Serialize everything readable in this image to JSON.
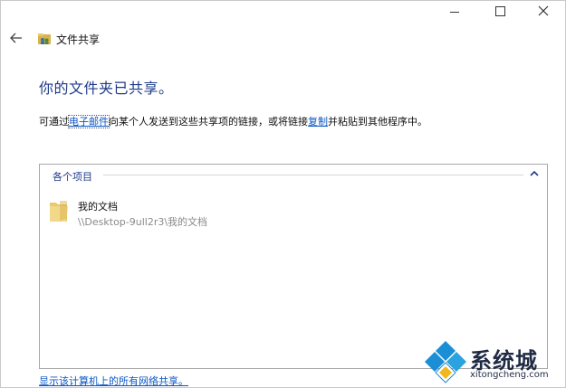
{
  "window": {
    "title": "文件共享",
    "caption": {
      "minimize": "minimize",
      "maximize": "maximize",
      "close": "close"
    }
  },
  "main": {
    "heading": "你的文件夹已共享。",
    "desc_before": "可通过",
    "email_link": "电子邮件",
    "desc_middle": "向某个人发送到这些共享项的链接，或将链接",
    "copy_link": "复制",
    "desc_after": "并粘贴到其他程序中。"
  },
  "panel": {
    "title": "各个项目",
    "items": [
      {
        "name": "我的文档",
        "path": "\\\\Desktop-9ull2r3\\我的文档",
        "icon": "folder-icon"
      }
    ]
  },
  "footer": {
    "link": "显示该计算机上的所有网络共享。"
  },
  "watermark": {
    "brand": "系统城",
    "url": "xitongcheng.com"
  },
  "colors": {
    "link": "#0b56c4",
    "heading": "#1e3a8a",
    "path_text": "#8a8a8a"
  }
}
